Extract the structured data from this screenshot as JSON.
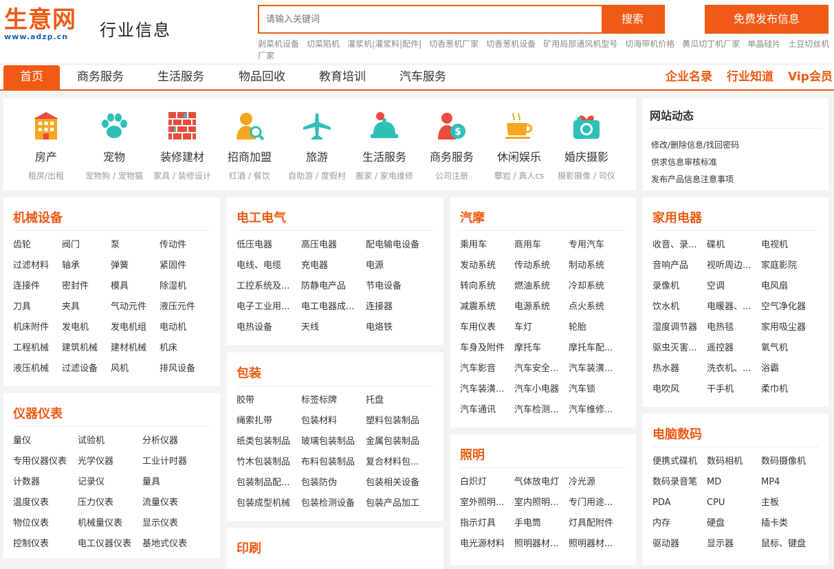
{
  "header": {
    "logo_text": "生意网",
    "logo_domain": "www.adzp.cn",
    "slogan": "行业信息",
    "search_placeholder": "请输入关键词",
    "search_button": "搜索",
    "publish_button": "免费发布信息",
    "hot_words": [
      "剥菜机设备",
      "切菜陷机",
      "灌浆机|灌浆料|配件|",
      "切香葱机厂家",
      "切香葱机设备",
      "矿用局部通风机型号",
      "切海带机价格",
      "黄瓜切丁机厂家",
      "单晶硅片",
      "土豆切丝机厂家"
    ]
  },
  "nav": {
    "items": [
      "首页",
      "商务服务",
      "生活服务",
      "物品回收",
      "教育培训",
      "汽车服务"
    ],
    "active": "首页",
    "right_items": [
      "企业名录",
      "行业知道",
      "Vip会员"
    ]
  },
  "categories": [
    {
      "name": "房产",
      "sub": "租房/出租",
      "icon": "building-icon",
      "color": "#f5a623"
    },
    {
      "name": "宠物",
      "sub": "宠物狗 / 宠物猫",
      "icon": "paw-icon",
      "color": "#2fbfb7"
    },
    {
      "name": "装修建材",
      "sub": "家具 / 装修设计",
      "icon": "brick-wall-icon",
      "color": "#e84c3d"
    },
    {
      "name": "招商加盟",
      "sub": "红酒 / 餐饮",
      "icon": "person-search-icon",
      "color": "#f5a623"
    },
    {
      "name": "旅游",
      "sub": "自助游 / 度假村",
      "icon": "airplane-icon",
      "color": "#2fbfb7"
    },
    {
      "name": "生活服务",
      "sub": "搬家 / 家电维修",
      "icon": "service-bell-icon",
      "color": "#2fbfb7"
    },
    {
      "name": "商务服务",
      "sub": "公司注册",
      "icon": "business-money-icon",
      "color": "#f05a14"
    },
    {
      "name": "休闲娱乐",
      "sub": "攀岩 / 真人cs",
      "icon": "coffee-cup-icon",
      "color": "#f5a623"
    },
    {
      "name": "婚庆摄影",
      "sub": "摄影摄像 / 司仪",
      "icon": "camera-icon",
      "color": "#2fbfb7"
    }
  ],
  "news": {
    "title": "网站动态",
    "items": [
      "修改/删除信息/找回密码",
      "供求信息审核标准",
      "发布产品信息注意事项"
    ]
  },
  "sections": {
    "jixie": {
      "title": "机械设备",
      "links": [
        "齿轮",
        "阀门",
        "泵",
        "传动件",
        "过滤材料",
        "轴承",
        "弹簧",
        "紧固件",
        "连接件",
        "密封件",
        "模具",
        "除湿机",
        "刀具",
        "夹具",
        "气动元件",
        "液压元件",
        "机床附件",
        "发电机",
        "发电机组",
        "电动机",
        "工程机械",
        "建筑机械",
        "建材机械",
        "机床",
        "液压机械",
        "过滤设备",
        "风机",
        "排风设备"
      ]
    },
    "yiqi": {
      "title": "仪器仪表",
      "links": [
        "量仪",
        "试验机",
        "分析仪器",
        "专用仪器仪表",
        "光学仪器",
        "工业计时器",
        "计数器",
        "记录仪",
        "量具",
        "温度仪表",
        "压力仪表",
        "流量仪表",
        "物位仪表",
        "机械量仪表",
        "显示仪表",
        "控制仪表",
        "电工仪器仪表",
        "基地式仪表"
      ]
    },
    "diangong": {
      "title": "电工电气",
      "links": [
        "低压电器",
        "高压电器",
        "配电输电设备",
        "电线、电缆",
        "充电器",
        "电源",
        "工控系统及...",
        "防静电产品",
        "节电设备",
        "电子工业用...",
        "电工电器成...",
        "连接器",
        "电热设备",
        "天线",
        "电烙铁"
      ]
    },
    "baozhuang": {
      "title": "包装",
      "links": [
        "胶带",
        "标签标牌",
        "托盘",
        "绳索扎带",
        "包装材料",
        "塑料包装制品",
        "纸类包装制品",
        "玻璃包装制品",
        "金属包装制品",
        "竹木包装制品",
        "布料包装制品",
        "复合材料包...",
        "包装制品配...",
        "包装防伪",
        "包装相关设备",
        "包装成型机械",
        "包装检测设备",
        "包装产品加工"
      ]
    },
    "yinshua": {
      "title": "印刷"
    },
    "qimo": {
      "title": "汽摩",
      "links": [
        "乘用车",
        "商用车",
        "专用汽车",
        "发动系统",
        "传动系统",
        "制动系统",
        "转向系统",
        "燃油系统",
        "冷却系统",
        "减震系统",
        "电源系统",
        "点火系统",
        "车用仪表",
        "车灯",
        "轮胎",
        "车身及附件",
        "摩托车",
        "摩托车配...",
        "汽车影音",
        "汽车安全...",
        "汽车装潢...",
        "汽车装潢...",
        "汽车小电器",
        "汽车锁",
        "汽车通讯",
        "汽车检测...",
        "汽车维修..."
      ]
    },
    "zhaoming": {
      "title": "照明",
      "links": [
        "白炽灯",
        "气体放电灯",
        "冷光源",
        "室外照明...",
        "室内照明...",
        "专门用途...",
        "指示灯具",
        "手电筒",
        "灯具配附件",
        "电光源材料",
        "照明器材...",
        "照明器材..."
      ]
    },
    "jiayong": {
      "title": "家用电器",
      "links": [
        "收音、录...",
        "碟机",
        "电视机",
        "音响产品",
        "视听周边...",
        "家庭影院",
        "录像机",
        "空调",
        "电风扇",
        "饮水机",
        "电暖器、...",
        "空气净化器",
        "湿度调节器",
        "电热毯",
        "家用吸尘器",
        "驱虫灭害...",
        "遥控器",
        "氧气机",
        "热水器",
        "洗衣机、...",
        "浴霸",
        "电吹风",
        "干手机",
        "柔巾机"
      ]
    },
    "diannao": {
      "title": "电脑数码",
      "links": [
        "便携式碟机",
        "数码相机",
        "数码摄像机",
        "数码录音笔",
        "MD",
        "MP4",
        "PDA",
        "CPU",
        "主板",
        "内存",
        "硬盘",
        "插卡类",
        "驱动器",
        "显示器",
        "鼠标、键盘"
      ]
    }
  }
}
